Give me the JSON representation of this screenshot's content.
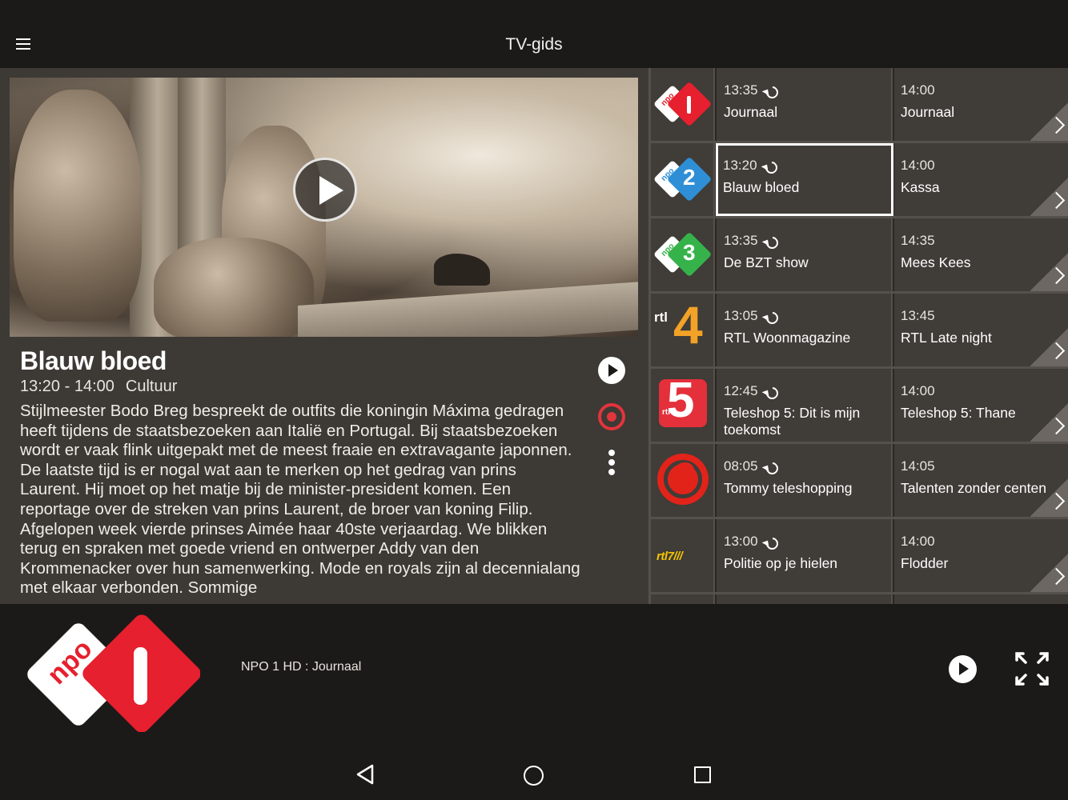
{
  "app": {
    "title": "TV-gids"
  },
  "program": {
    "title": "Blauw bloed",
    "time": "13:20 - 14:00",
    "genre": "Cultuur",
    "description": "Stijlmeester Bodo Breg bespreekt de outfits die koningin Máxima gedragen heeft tijdens de staatsbezoeken aan Italië en Portugal. Bij staatsbezoeken wordt er vaak flink uitgepakt met de meest fraaie en extravagante japonnen. De laatste tijd is er nogal wat aan te merken op het gedrag van prins Laurent. Hij moet op het matje bij de minister-president komen. Een reportage over de streken van prins Laurent, de broer van koning Filip. Afgelopen week vierde prinses Aimée haar 40ste verjaardag. We blikken terug en spraken met goede vriend en ontwerper Addy van den Krommenacker over hun samenwerking. Mode en royals zijn al decennialang met elkaar verbonden. Sommige"
  },
  "guide": [
    {
      "channel": "NPO 1",
      "logo": "npo1-logo",
      "now": {
        "time": "13:35",
        "title": "Journaal"
      },
      "next": {
        "time": "14:00",
        "title": "Journaal"
      }
    },
    {
      "channel": "NPO 2",
      "logo": "npo2-logo",
      "now": {
        "time": "13:20",
        "title": "Blauw bloed"
      },
      "next": {
        "time": "14:00",
        "title": "Kassa"
      }
    },
    {
      "channel": "NPO 3",
      "logo": "npo3-logo",
      "now": {
        "time": "13:35",
        "title": "De BZT show"
      },
      "next": {
        "time": "14:35",
        "title": "Mees Kees"
      }
    },
    {
      "channel": "RTL 4",
      "logo": "rtl4-logo",
      "now": {
        "time": "13:05",
        "title": "RTL Woonmagazine"
      },
      "next": {
        "time": "13:45",
        "title": "RTL Late night"
      }
    },
    {
      "channel": "RTL 5",
      "logo": "rtl5-logo",
      "now": {
        "time": "12:45",
        "title": "Teleshop 5: Dit is mijn toekomst"
      },
      "next": {
        "time": "14:00",
        "title": "Teleshop 5: Thane"
      }
    },
    {
      "channel": "SBS 6",
      "logo": "sbs6-logo",
      "now": {
        "time": "08:05",
        "title": "Tommy teleshopping"
      },
      "next": {
        "time": "14:05",
        "title": "Talenten zonder centen"
      }
    },
    {
      "channel": "RTL 7",
      "logo": "rtl7-logo",
      "now": {
        "time": "13:00",
        "title": "Politie op je hielen"
      },
      "next": {
        "time": "14:00",
        "title": "Flodder"
      }
    }
  ],
  "player": {
    "now_playing": "NPO 1 HD : Journaal"
  },
  "colors": {
    "npo_red": "#e6202e",
    "npo2_blue": "#2e8fd6",
    "npo3_green": "#35b34a",
    "rtl4_orange": "#f2a227",
    "rtl5_red": "#e3303a",
    "sbs6_red": "#e2231a",
    "rtl7_yellow": "#f5c400"
  }
}
